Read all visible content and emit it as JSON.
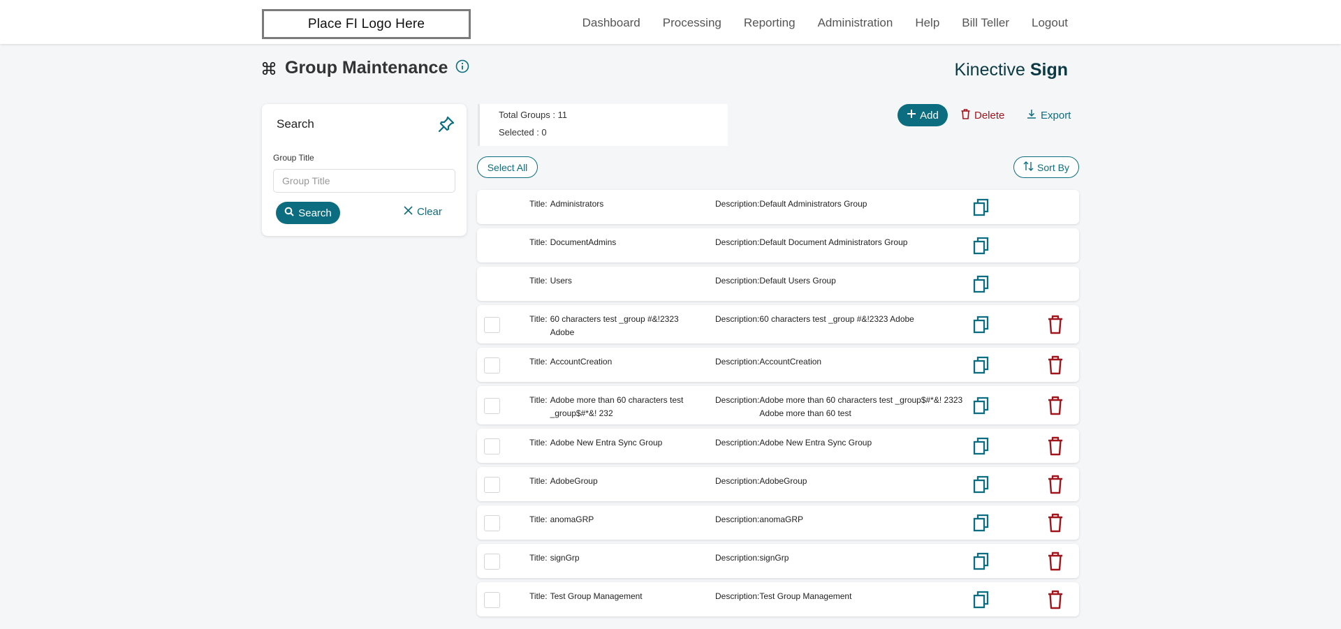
{
  "header": {
    "logo_text": "Place FI Logo Here",
    "nav": [
      "Dashboard",
      "Processing",
      "Reporting",
      "Administration",
      "Help",
      "Bill Teller",
      "Logout"
    ]
  },
  "page": {
    "title": "Group Maintenance",
    "brand_prefix": "Kinective ",
    "brand_suffix": "Sign"
  },
  "search": {
    "heading": "Search",
    "field_label": "Group Title",
    "field_placeholder": "Group Title",
    "field_value": "",
    "search_label": "Search",
    "clear_label": "Clear"
  },
  "summary": {
    "total_label": "Total Groups : 11",
    "selected_label": "Selected : 0"
  },
  "toolbar": {
    "add_label": "Add",
    "delete_label": "Delete",
    "export_label": "Export",
    "select_all_label": "Select All",
    "sort_by_label": "Sort By"
  },
  "row_labels": {
    "title": "Title:",
    "description": "Description:"
  },
  "rows": [
    {
      "title": "Administrators",
      "description": "Default Administrators Group",
      "selectable": false
    },
    {
      "title": "DocumentAdmins",
      "description": "Default Document Administrators Group",
      "selectable": false
    },
    {
      "title": "Users",
      "description": "Default Users Group",
      "selectable": false
    },
    {
      "title": "60 characters test _group #&!2323 Adobe",
      "description": "60 characters test _group #&!2323 Adobe",
      "selectable": true
    },
    {
      "title": "AccountCreation",
      "description": "AccountCreation",
      "selectable": true
    },
    {
      "title": "Adobe more than 60 characters test _group$#*&! 232",
      "description": "Adobe more than 60 characters test _group$#*&! 2323 Adobe more than 60 test",
      "selectable": true
    },
    {
      "title": "Adobe New Entra Sync Group",
      "description": "Adobe New Entra Sync Group",
      "selectable": true
    },
    {
      "title": "AdobeGroup",
      "description": "AdobeGroup",
      "selectable": true
    },
    {
      "title": "anomaGRP",
      "description": "anomaGRP",
      "selectable": true
    },
    {
      "title": "signGrp",
      "description": "signGrp",
      "selectable": true
    },
    {
      "title": "Test Group Management",
      "description": "Test Group Management",
      "selectable": true
    }
  ],
  "icons": {
    "title": "command-icon",
    "info": "info-icon",
    "pin": "pin-icon",
    "search": "search-icon",
    "clear": "close-icon",
    "add": "plus-icon",
    "delete": "trash-icon",
    "export": "download-icon",
    "sort": "sort-icon",
    "copy": "copy-icon"
  },
  "colors": {
    "primary": "#0b6d7f",
    "danger": "#a1161c",
    "background": "#f4f6f8",
    "brand_text": "#0c3a44"
  }
}
